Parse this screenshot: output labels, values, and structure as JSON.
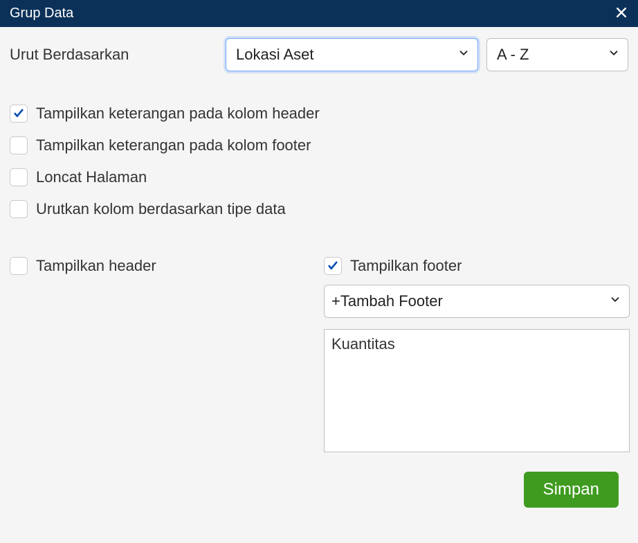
{
  "title": "Grup Data",
  "sort": {
    "label": "Urut Berdasarkan",
    "field": "Lokasi Aset",
    "order": "A - Z"
  },
  "checks": {
    "header_desc": "Tampilkan keterangan pada kolom header",
    "footer_desc": "Tampilkan keterangan pada kolom footer",
    "page_break": "Loncat Halaman",
    "sort_by_type": "Urutkan kolom berdasarkan tipe data",
    "show_header": "Tampilkan header",
    "show_footer": "Tampilkan footer"
  },
  "footer_section": {
    "add_label": "+Tambah Footer",
    "items": [
      "Kuantitas"
    ]
  },
  "buttons": {
    "save": "Simpan"
  }
}
